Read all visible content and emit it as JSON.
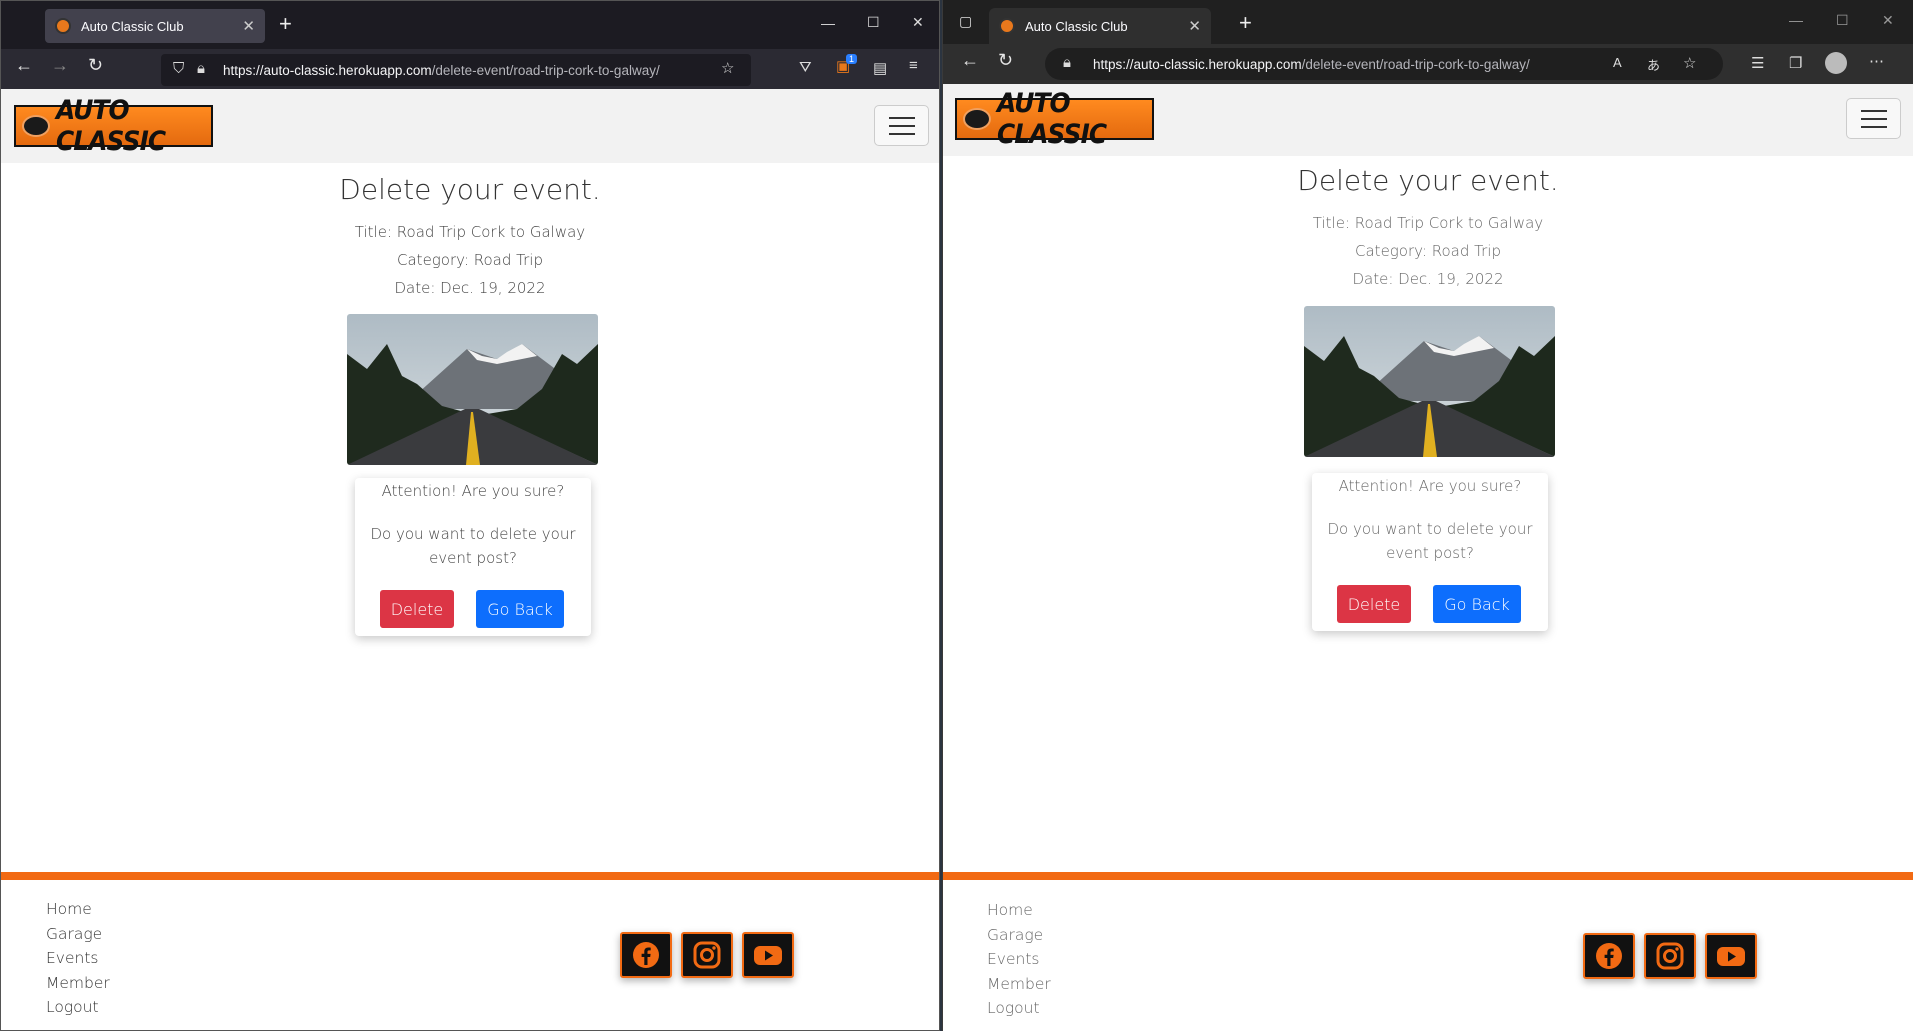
{
  "windows": [
    {
      "browser": "firefox",
      "tab_title": "Auto Classic Club",
      "url_host": "https://auto-classic.herokuapp.com",
      "url_path": "/delete-event/road-trip-cork-to-galway/",
      "extension_badge": "1"
    },
    {
      "browser": "edge",
      "tab_title": "Auto Classic Club",
      "url_host": "https://auto-classic.herokuapp.com",
      "url_path": "/delete-event/road-trip-cork-to-galway/"
    }
  ],
  "page": {
    "logo_text": "AUTO CLASSIC",
    "heading": "Delete your event.",
    "title_line": "Title: Road Trip Cork to Galway",
    "category_line": "Category: Road Trip",
    "date_line": "Date: Dec. 19, 2022",
    "confirm_question": "Attention! Are you sure?",
    "confirm_text": "Do you want to delete your event post?",
    "delete_label": "Delete",
    "back_label": "Go Back",
    "footer_links": [
      "Home",
      "Garage",
      "Events",
      "Member",
      "Logout"
    ],
    "social": [
      "facebook-icon",
      "instagram-icon",
      "youtube-icon"
    ],
    "colors": {
      "accent": "#f26a13",
      "danger": "#dc3545",
      "primary": "#0d6efd"
    }
  }
}
